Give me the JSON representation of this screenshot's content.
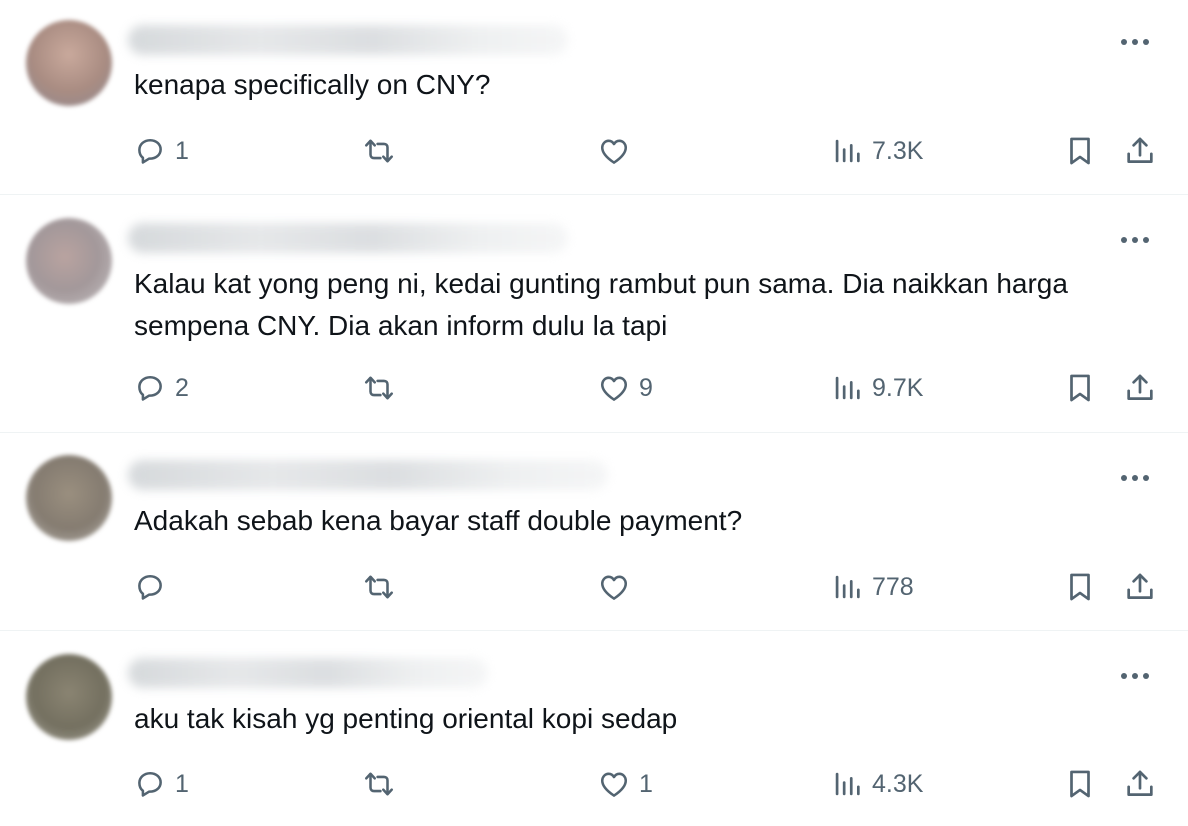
{
  "replies": [
    {
      "text": "kenapa specifically on CNY?",
      "replies_count": "1",
      "reposts_count": "",
      "likes_count": "",
      "views_count": "7.3K",
      "avatar_color": "#b79a90"
    },
    {
      "text": "Kalau kat yong peng ni, kedai gunting rambut pun sama. Dia naikkan harga sempena CNY. Dia akan inform dulu la tapi",
      "replies_count": "2",
      "reposts_count": "",
      "likes_count": "9",
      "views_count": "9.7K",
      "avatar_color": "#a69e9d"
    },
    {
      "text": "Adakah sebab kena bayar staff double payment?",
      "replies_count": "",
      "reposts_count": "",
      "likes_count": "",
      "views_count": "778",
      "avatar_color": "#8e8679"
    },
    {
      "text": "aku tak kisah yg penting oriental kopi sedap",
      "replies_count": "1",
      "reposts_count": "",
      "likes_count": "1",
      "views_count": "4.3K",
      "avatar_color": "#7d7a6d"
    }
  ],
  "icons": {
    "reply": "speech-bubble-icon",
    "repost": "repost-arrows-icon",
    "like": "heart-icon",
    "views": "bar-chart-icon",
    "bookmark": "bookmark-icon",
    "share": "share-upload-icon",
    "more": "more-dots-icon"
  },
  "colors": {
    "icon": "#536471",
    "text": "#0f1419",
    "divider": "#eff3f4"
  }
}
